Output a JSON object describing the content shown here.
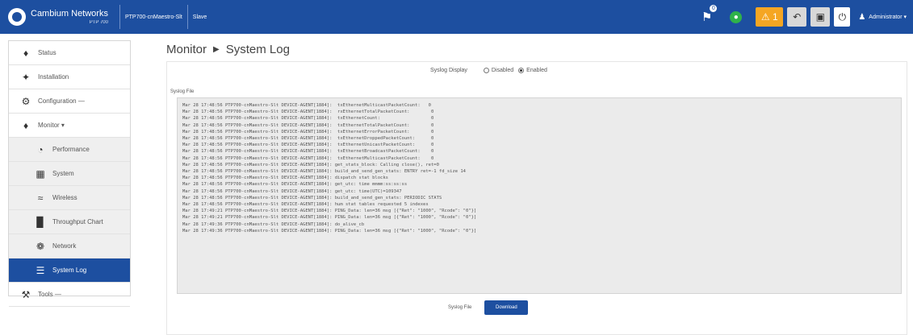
{
  "header": {
    "brand_name": "Cambium Networks",
    "brand_sub": "PTP 700",
    "device_name": "PTP700-cnMaestro-Slt",
    "mode": "Slave",
    "alerts_count": "0",
    "warning_count": "1",
    "user_label": "Administrator"
  },
  "sidebar": {
    "items": [
      {
        "label": "Status",
        "icon": "status-icon"
      },
      {
        "label": "Installation",
        "icon": "installation-icon"
      },
      {
        "label": "Configuration",
        "icon": "gear-icon"
      },
      {
        "label": "Monitor",
        "icon": "monitor-icon"
      },
      {
        "label": "Performance",
        "icon": "gauge-icon"
      },
      {
        "label": "System",
        "icon": "system-icon"
      },
      {
        "label": "Wireless",
        "icon": "wifi-icon"
      },
      {
        "label": "Throughput Chart",
        "icon": "chart-icon"
      },
      {
        "label": "Network",
        "icon": "network-icon"
      },
      {
        "label": "System Log",
        "icon": "log-icon"
      },
      {
        "label": "Tools",
        "icon": "wrench-icon"
      }
    ]
  },
  "page": {
    "section": "Monitor",
    "title": "System Log",
    "syslog_display_label": "Syslog Display",
    "disabled_label": "Disabled",
    "enabled_label": "Enabled",
    "syslog_display_value": "Enabled",
    "syslog_file_label": "Syslog File",
    "bottom_file_label": "Syslog File",
    "download_label": "Download"
  },
  "log": {
    "lines": [
      "Mar 28 17:48:56 PTP700-cnMaestro-Slt DEVICE-AGENT[1884]:  txEthernetMulticastPacketCount:   0",
      "Mar 28 17:48:56 PTP700-cnMaestro-Slt DEVICE-AGENT[1884]:  rxEthernetTotalPacketCount:        0",
      "Mar 28 17:48:56 PTP700-cnMaestro-Slt DEVICE-AGENT[1884]:  txEthernetCount:                   0",
      "Mar 28 17:48:56 PTP700-cnMaestro-Slt DEVICE-AGENT[1884]:  txEthernetTotalPacketCount:        0",
      "Mar 28 17:48:56 PTP700-cnMaestro-Slt DEVICE-AGENT[1884]:  txEthernetErrorPacketCount:        0",
      "Mar 28 17:48:56 PTP700-cnMaestro-Slt DEVICE-AGENT[1884]:  txEthernetDroppedPacketCount:      0",
      "Mar 28 17:48:56 PTP700-cnMaestro-Slt DEVICE-AGENT[1884]:  txEthernetUnicastPacketCount:      0",
      "Mar 28 17:48:56 PTP700-cnMaestro-Slt DEVICE-AGENT[1884]:  txEthernetBroadcastPacketCount:    0",
      "Mar 28 17:48:56 PTP700-cnMaestro-Slt DEVICE-AGENT[1884]:  txEthernetMulticastPacketCount:    0",
      "Mar 28 17:48:56 PTP700-cnMaestro-Slt DEVICE-AGENT[1884]: get_stats_block: Calling close(), ret=0",
      "Mar 28 17:48:56 PTP700-cnMaestro-Slt DEVICE-AGENT[1884]: build_and_send_gen_stats: ENTRY ret=-1 fd_size 14",
      "Mar 28 17:48:56 PTP700-cnMaestro-Slt DEVICE-AGENT[1884]: dispatch stat blocks",
      "Mar 28 17:48:56 PTP700-cnMaestro-Slt DEVICE-AGENT[1884]: get_utc: time mmmm:ss:ss:ss",
      "Mar 28 17:48:56 PTP700-cnMaestro-Slt DEVICE-AGENT[1884]: get_utc: time(UTC)=109347",
      "Mar 28 17:48:56 PTP700-cnMaestro-Slt DEVICE-AGENT[1884]: build_and_send_gen_stats: PERIODIC STATS",
      "Mar 28 17:48:56 PTP700-cnMaestro-Slt DEVICE-AGENT[1884]: hum stat tables requested 5 indexes",
      "Mar 28 17:49:21 PTP700-cnMaestro-Slt DEVICE-AGENT[1884]: PING_Data: len=36 msg [{\"Ret\": \"1000\", \"Rcode\": \"0\"}]",
      "Mar 28 17:49:21 PTP700-cnMaestro-Slt DEVICE-AGENT[1884]: PING_Data: len=36 msg [{\"Ret\": \"1000\", \"Rcode\": \"0\"}]",
      "Mar 28 17:49:36 PTP700-cnMaestro-Slt DEVICE-AGENT[1884]: do_alive_cb",
      "Mar 28 17:49:36 PTP700-cnMaestro-Slt DEVICE-AGENT[1884]: PING_Data: len=36 msg [{\"Ret\": \"1000\", \"Rcode\": \"0\"}]"
    ]
  }
}
